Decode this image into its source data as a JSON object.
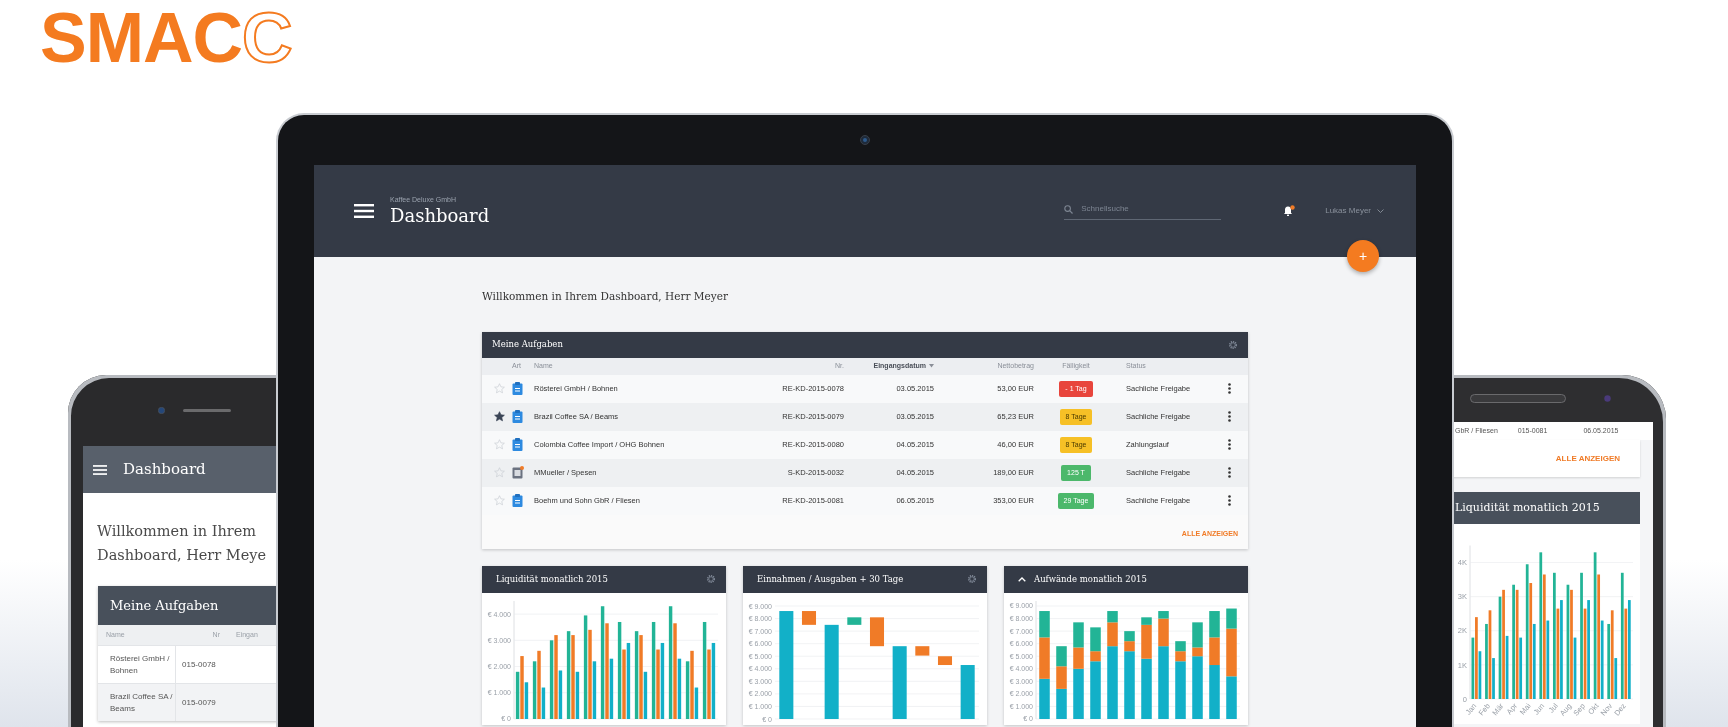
{
  "logo": {
    "text": "SMAC",
    "outline": "C"
  },
  "laptop": {
    "header": {
      "company": "Kaffee Deluxe GmbH",
      "title": "Dashboard",
      "search": {
        "placeholder": "Schnellsuche"
      },
      "notifications": {
        "unread": true
      },
      "user": "Lukas Meyer"
    },
    "fab": "+",
    "welcome": "Willkommen in Ihrem Dashboard, Herr Meyer",
    "tasks": {
      "title": "Meine Aufgaben",
      "columns": [
        {
          "label": "Art",
          "sorted": false
        },
        {
          "label": "Name",
          "sorted": false
        },
        {
          "label": "Nr.",
          "sorted": false
        },
        {
          "label": "Eingangsdatum",
          "sorted": true
        },
        {
          "label": "Nettobetrag",
          "sorted": false
        },
        {
          "label": "Fälligkeit",
          "sorted": false
        },
        {
          "label": "Status",
          "sorted": false
        }
      ],
      "rows": [
        {
          "starred": false,
          "kind": "invoice",
          "name": "Rösterei GmbH / Bohnen",
          "nr": "RE-KD-2015-0078",
          "date": "03.05.2015",
          "amount": "53,00 EUR",
          "due": {
            "text": "- 1 Tag",
            "color": "#e8453c"
          },
          "status": "Sachliche Freigabe"
        },
        {
          "starred": true,
          "kind": "invoice",
          "name": "Brazil Coffee SA / Beams",
          "nr": "RE-KD-2015-0079",
          "date": "03.05.2015",
          "amount": "65,23 EUR",
          "due": {
            "text": "8 Tage",
            "color": "#f6c026"
          },
          "status": "Sachliche Freigabe"
        },
        {
          "starred": false,
          "kind": "invoice",
          "name": "Colombia Coffee Import / OHG Bohnen",
          "nr": "RE-KD-2015-0080",
          "date": "04.05.2015",
          "amount": "46,00 EUR",
          "due": {
            "text": "8 Tage",
            "color": "#f6c026"
          },
          "status": "Zahlungslauf"
        },
        {
          "starred": false,
          "kind": "expense",
          "name": "MMueller / Spesen",
          "nr": "S-KD-2015-0032",
          "date": "04.05.2015",
          "amount": "189,00 EUR",
          "due": {
            "text": "125 T",
            "color": "#4cb86b"
          },
          "status": "Sachliche Freigabe"
        },
        {
          "starred": false,
          "kind": "invoice",
          "name": "Boehm und Sohn GbR / Fliesen",
          "nr": "RE-KD-2015-0081",
          "date": "06.05.2015",
          "amount": "353,00 EUR",
          "due": {
            "text": "29 Tage",
            "color": "#4cb86b"
          },
          "status": "Sachliche Freigabe"
        }
      ],
      "show_all": "ALLE ANZEIGEN"
    },
    "charts": [
      {
        "has_settings": true,
        "collapsible": false,
        "chart_data": {
          "type": "bar",
          "title": "Liquidität monatlich 2015",
          "grid": true,
          "ylim": [
            0,
            4500
          ],
          "yticks": [
            {
              "value": 0,
              "label": "€ 0"
            },
            {
              "value": 1000,
              "label": "€ 1.000"
            },
            {
              "value": 2000,
              "label": "€ 2.000"
            },
            {
              "value": 3000,
              "label": "€ 3.000"
            },
            {
              "value": 4000,
              "label": "€ 4.000"
            }
          ],
          "series": [
            {
              "color": "#22b496",
              "values": [
                1800,
                2200,
                3000,
                3350,
                3950,
                4300,
                3700,
                3350,
                3700,
                4300,
                2200,
                3700
              ]
            },
            {
              "color": "#f07b27",
              "values": [
                2400,
                2600,
                3200,
                3200,
                3400,
                3650,
                2650,
                3200,
                2650,
                3650,
                2600,
                2650
              ]
            },
            {
              "color": "#12b0c8",
              "values": [
                1400,
                1200,
                1850,
                1800,
                2200,
                2300,
                2900,
                1800,
                2900,
                2300,
                1200,
                2900
              ]
            }
          ]
        }
      },
      {
        "has_settings": true,
        "collapsible": false,
        "title": "Einnahmen / Ausgaben + 30 Tage",
        "axis_labels": [
          "€ 9.000",
          "€ 8.000",
          "€ 7.000",
          "€ 6.000",
          "€ 5.000",
          "€ 4.000",
          "€ 3.000",
          "€ 2.000",
          "€ 1.000",
          "€ 0"
        ]
      },
      {
        "has_settings": false,
        "collapsible": true,
        "chart_data": {
          "type": "bar",
          "title": "Aufwände monatlich 2015",
          "grid": true,
          "stacked": true,
          "ylim": [
            0,
            9400
          ],
          "yticks": [
            {
              "value": 0,
              "label": "€ 0"
            },
            {
              "value": 1000,
              "label": "€ 1.000"
            },
            {
              "value": 2000,
              "label": "€ 2.000"
            },
            {
              "value": 3000,
              "label": "€ 3.000"
            },
            {
              "value": 4000,
              "label": "€ 4.000"
            },
            {
              "value": 5000,
              "label": "€ 5.000"
            },
            {
              "value": 6000,
              "label": "€ 6.000"
            },
            {
              "value": 7000,
              "label": "€ 7.000"
            },
            {
              "value": 8000,
              "label": "€ 8.000"
            },
            {
              "value": 9000,
              "label": "€ 9.000"
            }
          ],
          "series": [
            {
              "color": "#12b0c8",
              "values": [
                3200,
                2400,
                4000,
                4600,
                5800,
                5400,
                4800,
                5800,
                4600,
                5000,
                4300,
                3400
              ]
            },
            {
              "color": "#f07b27",
              "values": [
                3300,
                1800,
                1700,
                800,
                1900,
                800,
                2700,
                2200,
                800,
                700,
                2200,
                3800
              ]
            },
            {
              "color": "#22b496",
              "values": [
                2100,
                1600,
                2000,
                1900,
                900,
                800,
                600,
                600,
                800,
                2000,
                2100,
                1600
              ]
            }
          ]
        }
      }
    ]
  },
  "phone_left": {
    "title": "Dashboard",
    "welcome": "Willkommen in Ihrem Dashboard, Herr Meye",
    "tasks": {
      "title": "Meine Aufgaben",
      "columns": [
        "Name",
        "Nr",
        "Eingan"
      ],
      "rows": [
        [
          "Rösterei GmbH / Bohnen",
          "015-0078"
        ],
        [
          "Brazil Coffee SA / Beams",
          "015-0079"
        ]
      ]
    }
  },
  "phone_right": {
    "partial_row": [
      "GbR / Fliesen",
      "015-0081",
      "06.05.2015"
    ],
    "show_all": "ALLE ANZEIGEN",
    "chart_data": {
      "type": "bar",
      "title": "Liquidität monatlich 2015",
      "grid": true,
      "categories": [
        "Jan",
        "Feb",
        "Mär",
        "Apr",
        "Mai",
        "Jun",
        "Jul",
        "Aug",
        "Sep",
        "Okt",
        "Nov",
        "Dez"
      ],
      "ylim": [
        0,
        4500
      ],
      "yticks": [
        {
          "value": 0,
          "label": "0"
        },
        {
          "value": 1000,
          "label": "1K"
        },
        {
          "value": 2000,
          "label": "2K"
        },
        {
          "value": 3000,
          "label": "3K"
        },
        {
          "value": 4000,
          "label": "4K"
        }
      ],
      "series": [
        {
          "color": "#22b496",
          "values": [
            1800,
            2200,
            3000,
            3350,
            3950,
            4300,
            3700,
            3350,
            3700,
            4300,
            2200,
            3700
          ]
        },
        {
          "color": "#f07b27",
          "values": [
            2400,
            2600,
            3200,
            3200,
            3400,
            3650,
            2650,
            3200,
            2650,
            3650,
            2600,
            2650
          ]
        },
        {
          "color": "#12b0c8",
          "values": [
            1400,
            1200,
            1850,
            1800,
            2200,
            2300,
            2900,
            1800,
            2900,
            2300,
            1200,
            2900
          ]
        }
      ]
    }
  }
}
